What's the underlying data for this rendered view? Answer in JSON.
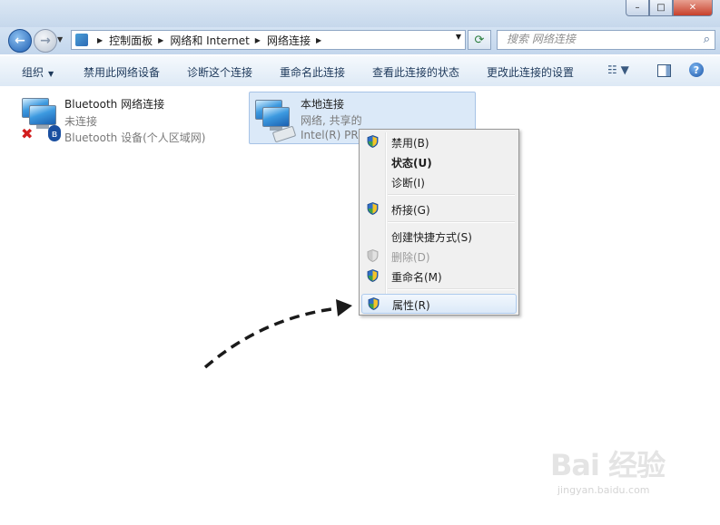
{
  "window": {
    "minimize": "–",
    "maximize": "□",
    "close": "✕"
  },
  "nav": {
    "back_icon": "←",
    "forward_icon": "→",
    "history_icon": "▼",
    "breadcrumb": [
      "控制面板",
      "网络和 Internet",
      "网络连接"
    ],
    "address_dropdown_icon": "▼",
    "refresh_icon": "⟳",
    "search_placeholder": "搜索 网络连接",
    "search_icon": "⌕"
  },
  "toolbar": {
    "organize": "组织",
    "items": [
      "禁用此网络设备",
      "诊断这个连接",
      "重命名此连接",
      "查看此连接的状态",
      "更改此连接的设置"
    ],
    "view_icon": "☷ ▼",
    "help_icon": "?"
  },
  "connections": [
    {
      "name": "Bluetooth 网络连接",
      "status": "未连接",
      "device": "Bluetooth 设备(个人区域网)",
      "error_icon": "✖",
      "bluetooth_icon": "ʙ"
    },
    {
      "name": "本地连接",
      "status": "网络, 共享的",
      "device": "Intel(R) PRO/1000 MT Network Connection",
      "selected": true
    }
  ],
  "context_menu": {
    "items": [
      {
        "label": "禁用(B)",
        "icon": "shield-icon"
      },
      {
        "label": "状态(U)",
        "bold": true
      },
      {
        "label": "诊断(I)"
      },
      {
        "label": "桥接(G)",
        "icon": "shield-icon"
      },
      {
        "label": "创建快捷方式(S)"
      },
      {
        "label": "删除(D)",
        "icon": "shield-icon",
        "disabled": true
      },
      {
        "label": "重命名(M)",
        "icon": "shield-icon"
      },
      {
        "label": "属性(R)",
        "icon": "shield-icon",
        "highlighted": true
      }
    ]
  },
  "annotation": {
    "arrow_color": "#1a1a1a"
  },
  "watermark": {
    "brand": "Bai 经验",
    "url": "jingyan.baidu.com"
  }
}
